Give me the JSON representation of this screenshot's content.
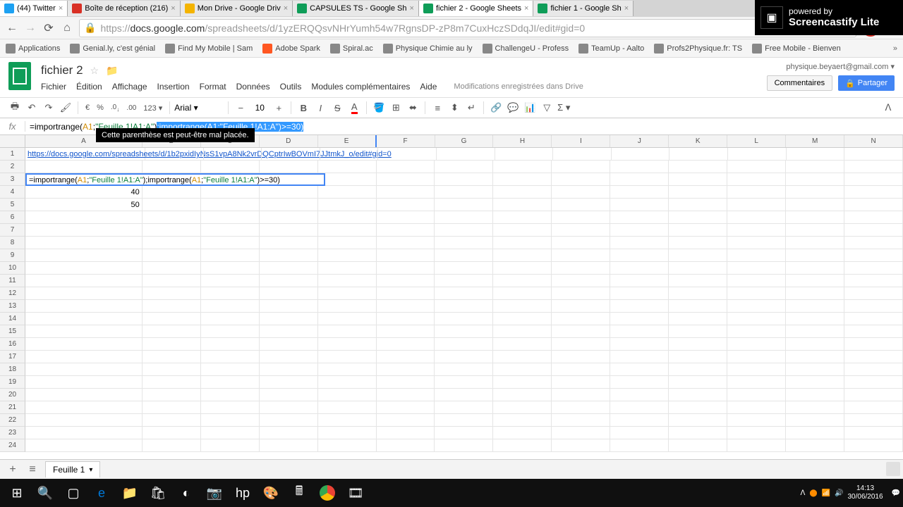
{
  "browser": {
    "tabs": [
      {
        "label": "(44) Twitter",
        "icon": "twitter"
      },
      {
        "label": "Boîte de réception (216)",
        "icon": "gmail"
      },
      {
        "label": "Mon Drive - Google Driv",
        "icon": "gdrive"
      },
      {
        "label": "CAPSULES TS - Google Sh",
        "icon": "gsheets"
      },
      {
        "label": "fichier 2 - Google Sheets",
        "icon": "gsheets",
        "active": true
      },
      {
        "label": "fichier 1 - Google Sh",
        "icon": "gsheets"
      }
    ],
    "url_display": "https://docs.google.com/spreadsheets/d/1yzERQQsvNHrYumh54w7RgnsDP-zP8m7CuxHczSDdqJI/edit#gid=0",
    "bookmarks": [
      {
        "label": "Applications"
      },
      {
        "label": "Genial.ly, c'est génial"
      },
      {
        "label": "Find My Mobile | Sam"
      },
      {
        "label": "Adobe Spark"
      },
      {
        "label": "Spiral.ac"
      },
      {
        "label": "Physique Chimie au ly"
      },
      {
        "label": "ChallengeU - Profess"
      },
      {
        "label": "TeamUp - Aalto"
      },
      {
        "label": "Profs2Physique.fr: TS"
      },
      {
        "label": "Free Mobile - Bienven"
      }
    ]
  },
  "screencastify": {
    "line1": "powered by",
    "line2": "Screencastify Lite"
  },
  "sheets": {
    "doc_title": "fichier 2",
    "user_email": "physique.beyaert@gmail.com",
    "comments_label": "Commentaires",
    "share_label": "Partager",
    "menus": [
      "Fichier",
      "Édition",
      "Affichage",
      "Insertion",
      "Format",
      "Données",
      "Outils",
      "Modules complémentaires",
      "Aide"
    ],
    "save_msg": "Modifications enregistrées dans Drive",
    "toolbar": {
      "currency": "€",
      "percent": "%",
      "dec": ".0",
      "dec2": ".00",
      "num_format": "123",
      "font": "Arial",
      "size": "10"
    },
    "formula_bar": {
      "prefix": "=importrange(",
      "ref1": "A1",
      "mid1": ";",
      "str1": "\"Feuille 1!A1:A\"",
      "sel": ";importrange(A1;\"Feuille 1!A1:A\")>=30)",
      "tooltip": "Cette parenthèse est peut-être mal placée."
    },
    "columns": [
      "A",
      "B",
      "C",
      "D",
      "E",
      "F",
      "G",
      "H",
      "I",
      "J",
      "K",
      "L",
      "M",
      "N"
    ],
    "rows_count": 24,
    "cells": {
      "A1": "https://docs.google.com/spreadsheets/d/1b2pxidIyNsS1vpA8Nk2vrDQCptrIwBOVmI7JJtmkJ_o/edit#gid=0",
      "A3_formula": "=importrange(A1;\"Feuille 1!A1:A\");importrange(A1;\"Feuille 1!A1:A\")>=30)",
      "A4": "40",
      "A5": "50"
    },
    "sheet_tab": "Feuille 1"
  },
  "taskbar": {
    "time": "14:13",
    "date": "30/06/2016"
  }
}
